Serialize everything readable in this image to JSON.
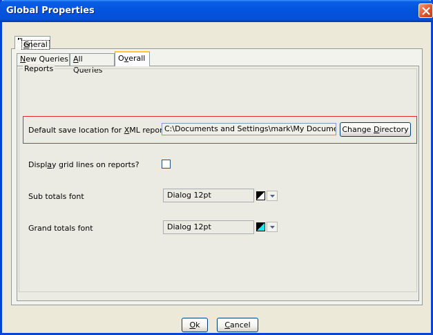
{
  "window": {
    "title": "Global Properties"
  },
  "outer_tabs": [
    {
      "label": "General",
      "mnemonic": "G",
      "rest": "eneral"
    }
  ],
  "inner_tabs": [
    {
      "label": "New Queries",
      "mnemonic": "N",
      "rest": "ew Queries"
    },
    {
      "label": "All Queries",
      "mnemonic": "A",
      "rest": "ll Queries"
    },
    {
      "pre": "O",
      "mnemonic": "v",
      "rest": "erall",
      "label": "Overall",
      "active": true
    }
  ],
  "reports": {
    "group_label": "Reports",
    "save_location": {
      "label_pre": "Default save location for ",
      "label_mnemonic": "X",
      "label_post": "ML reports",
      "value": "C:\\Documents and Settings\\mark\\My Documents\\m",
      "button_pre": "Change ",
      "button_mnemonic": "D",
      "button_post": "irectory"
    },
    "grid_lines": {
      "label_pre": "Displ",
      "label_mnemonic": "a",
      "label_post": "y grid lines on reports?",
      "checked": false
    },
    "sub_totals": {
      "label": "Sub totals font",
      "value": "Dialog 12pt",
      "color": "#000000"
    },
    "grand_totals": {
      "label": "Grand totals font",
      "value": "Dialog 12pt",
      "color": "#20e6e6"
    }
  },
  "buttons": {
    "ok": {
      "mnemonic": "O",
      "rest": "k"
    },
    "cancel": {
      "mnemonic": "C",
      "rest": "ancel"
    }
  },
  "icons": [
    "close-icon",
    "dropdown-arrow-icon"
  ]
}
